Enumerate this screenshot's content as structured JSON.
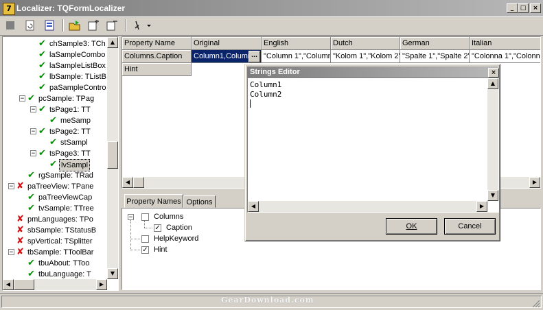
{
  "window": {
    "icon_letter": "7",
    "title": "Localizer: TQFormLocalizer",
    "controls": [
      "_",
      "□",
      "×"
    ]
  },
  "toolbar": {
    "buttons": [
      "stop-icon",
      "refresh-doc-icon",
      "properties-doc-icon",
      "open-folder-icon",
      "export-doc-icon",
      "import-doc-icon",
      "language-dropdown-icon"
    ]
  },
  "tree": {
    "items": [
      {
        "label": "chSample3: TCh",
        "mark": "check"
      },
      {
        "label": "laSampleCombo",
        "mark": "check"
      },
      {
        "label": "laSampleListBox",
        "mark": "check"
      },
      {
        "label": "lbSample: TListB",
        "mark": "check"
      },
      {
        "label": "paSampleContro",
        "mark": "check"
      },
      {
        "label": "pcSample: TPag",
        "mark": "check",
        "expander": "−"
      },
      {
        "label": "tsPage1: TT",
        "mark": "check",
        "expander": "−"
      },
      {
        "label": "meSamp",
        "mark": "check"
      },
      {
        "label": "tsPage2: TT",
        "mark": "check",
        "expander": "−"
      },
      {
        "label": "stSampl",
        "mark": "check"
      },
      {
        "label": "tsPage3: TT",
        "mark": "check",
        "expander": "−"
      },
      {
        "label": "lvSampl",
        "mark": "check",
        "selected": true
      },
      {
        "label": "rgSample: TRad",
        "mark": "check"
      },
      {
        "label": "paTreeView: TPane",
        "mark": "cross",
        "expander": "−"
      },
      {
        "label": "paTreeViewCap",
        "mark": "check"
      },
      {
        "label": "tvSample: TTree",
        "mark": "check"
      },
      {
        "label": "pmLanguages: TPo",
        "mark": "cross"
      },
      {
        "label": "sbSample: TStatusB",
        "mark": "cross"
      },
      {
        "label": "spVertical: TSplitter",
        "mark": "cross"
      },
      {
        "label": "tbSample: TToolBar",
        "mark": "cross",
        "expander": "−"
      },
      {
        "label": "tbuAbout: TToo",
        "mark": "check"
      },
      {
        "label": "tbuLanguage: T",
        "mark": "check"
      }
    ]
  },
  "grid": {
    "headers": [
      "Property Name",
      "Original",
      "English",
      "Dutch",
      "German",
      "Italian"
    ],
    "rows": [
      [
        "Columns.Caption",
        "Column1,Column",
        "\"Column 1\",\"Column",
        "\"Kolom 1\",\"Kolom 2\"",
        "\"Spalte 1\",\"Spalte 2\"",
        "\"Colonna 1\",\"Colonn"
      ],
      [
        "Hint",
        "",
        "",
        "",
        "",
        ""
      ]
    ],
    "ellipsis": "..."
  },
  "tabs": {
    "property_names": "Property Names",
    "options": "Options"
  },
  "props": {
    "columns": "Columns",
    "caption": "Caption",
    "help_keyword": "HelpKeyword",
    "hint": "Hint"
  },
  "dialog": {
    "title": "Strings Editor",
    "lines": [
      "Column1",
      "Column2"
    ],
    "ok": "OK",
    "cancel": "Cancel"
  },
  "watermark": "GearDownload.com"
}
